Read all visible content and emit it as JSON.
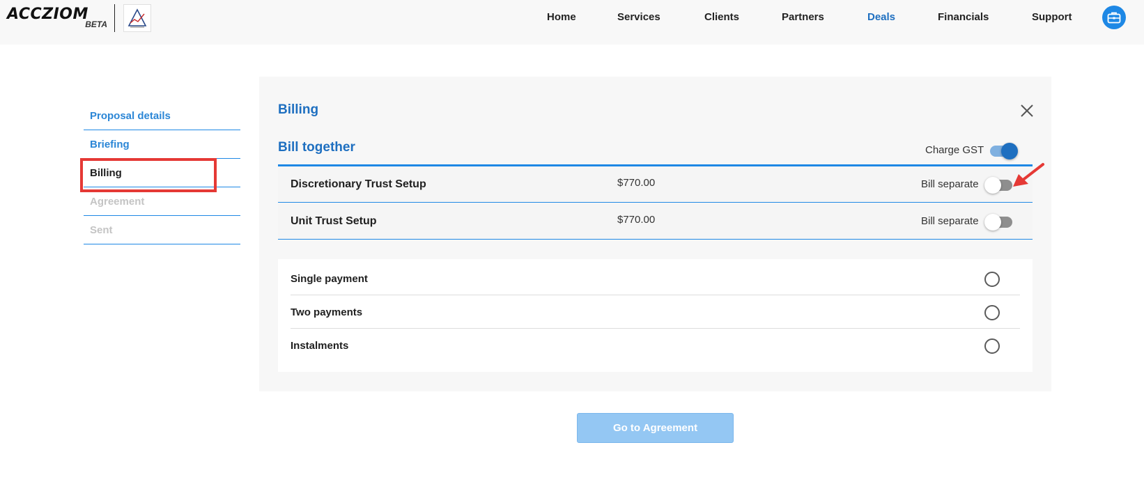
{
  "brand": {
    "name": "ACCZIOM",
    "tag": "BETA"
  },
  "nav": [
    {
      "label": "Home",
      "active": false
    },
    {
      "label": "Services",
      "active": false
    },
    {
      "label": "Clients",
      "active": false
    },
    {
      "label": "Partners",
      "active": false
    },
    {
      "label": "Deals",
      "active": true
    },
    {
      "label": "Financials",
      "active": false
    },
    {
      "label": "Support",
      "active": false
    }
  ],
  "steps": [
    {
      "label": "Proposal details",
      "state": "done"
    },
    {
      "label": "Briefing",
      "state": "done"
    },
    {
      "label": "Billing",
      "state": "current"
    },
    {
      "label": "Agreement",
      "state": "todo"
    },
    {
      "label": "Sent",
      "state": "todo"
    }
  ],
  "panel": {
    "title": "Billing",
    "section_title": "Bill together",
    "gst": {
      "label": "Charge GST",
      "on": true
    },
    "items": [
      {
        "name": "Discretionary Trust Setup",
        "amount": "$770.00",
        "toggle_label": "Bill separate",
        "on": false
      },
      {
        "name": "Unit Trust Setup",
        "amount": "$770.00",
        "toggle_label": "Bill separate",
        "on": false
      }
    ],
    "payment_options": [
      {
        "label": "Single payment",
        "selected": false
      },
      {
        "label": "Two payments",
        "selected": false
      },
      {
        "label": "Instalments",
        "selected": false
      }
    ]
  },
  "cta": {
    "label": "Go to Agreement"
  },
  "colors": {
    "accent": "#1e6fc0",
    "rule": "#1e88e5",
    "annotation": "#e53935",
    "cta_disabled": "#94c7f3"
  }
}
